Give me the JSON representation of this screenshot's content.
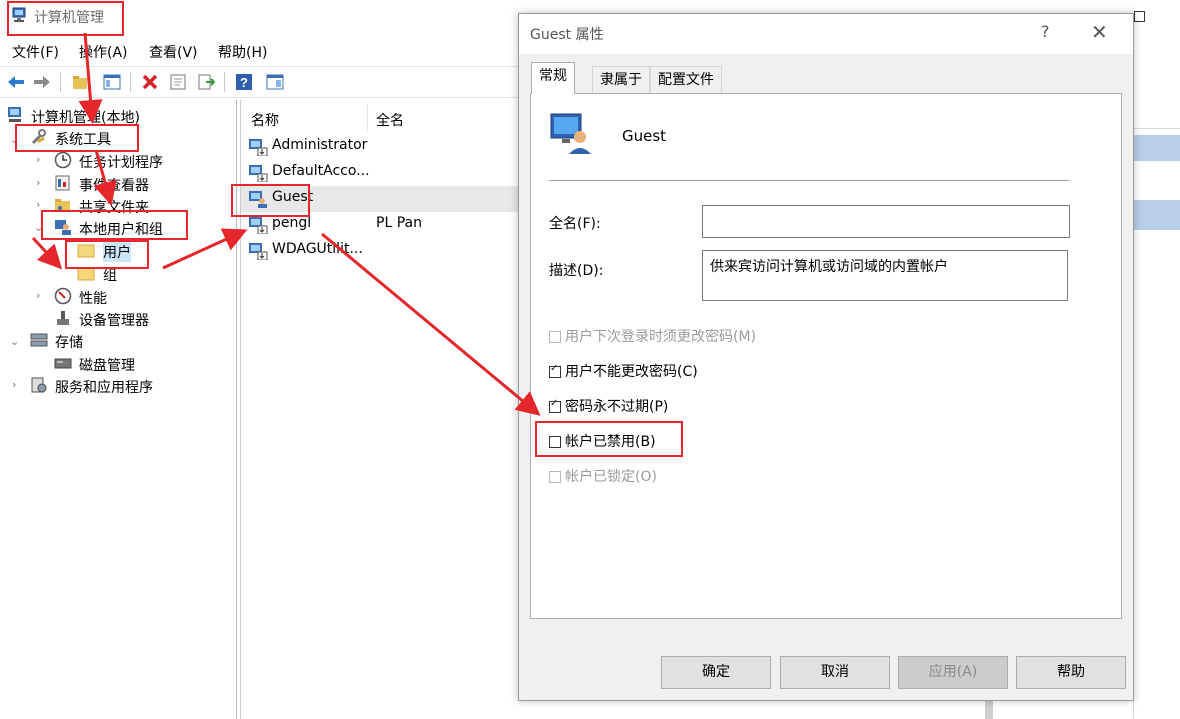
{
  "window": {
    "title": "计算机管理",
    "menu": [
      "文件(F)",
      "操作(A)",
      "查看(V)",
      "帮助(H)"
    ]
  },
  "tree": {
    "root": "计算机管理(本地)",
    "system_tools": "系统工具",
    "task_scheduler": "任务计划程序",
    "event_viewer": "事件查看器",
    "shared_folders": "共享文件夹",
    "local_users_groups": "本地用户和组",
    "users": "用户",
    "groups": "组",
    "performance": "性能",
    "device_manager": "设备管理器",
    "storage": "存储",
    "disk_management": "磁盘管理",
    "services_apps": "服务和应用程序"
  },
  "list": {
    "col_name": "名称",
    "col_fullname": "全名",
    "rows": [
      {
        "name": "Administrator",
        "full": ""
      },
      {
        "name": "DefaultAcco...",
        "full": ""
      },
      {
        "name": "Guest",
        "full": ""
      },
      {
        "name": "pengl",
        "full": "PL Pan"
      },
      {
        "name": "WDAGUtilit...",
        "full": ""
      }
    ]
  },
  "dialog": {
    "title": "Guest 属性",
    "help": "?",
    "tabs": [
      "常规",
      "隶属于",
      "配置文件"
    ],
    "user_name": "Guest",
    "fullname_label": "全名(F):",
    "fullname_value": "",
    "description_label": "描述(D):",
    "description_value": "供来宾访问计算机或访问域的内置帐户",
    "checkboxes": [
      {
        "label": "用户下次登录时须更改密码(M)",
        "checked": false,
        "disabled": true
      },
      {
        "label": "用户不能更改密码(C)",
        "checked": true,
        "disabled": false
      },
      {
        "label": "密码永不过期(P)",
        "checked": true,
        "disabled": false
      },
      {
        "label": "帐户已禁用(B)",
        "checked": false,
        "disabled": false
      },
      {
        "label": "帐户已锁定(O)",
        "checked": false,
        "disabled": true
      }
    ],
    "buttons": {
      "ok": "确定",
      "cancel": "取消",
      "apply": "应用(A)",
      "help": "帮助"
    }
  },
  "colors": {
    "annotation_red": "#e5262a",
    "selection": "#cce4f7"
  }
}
